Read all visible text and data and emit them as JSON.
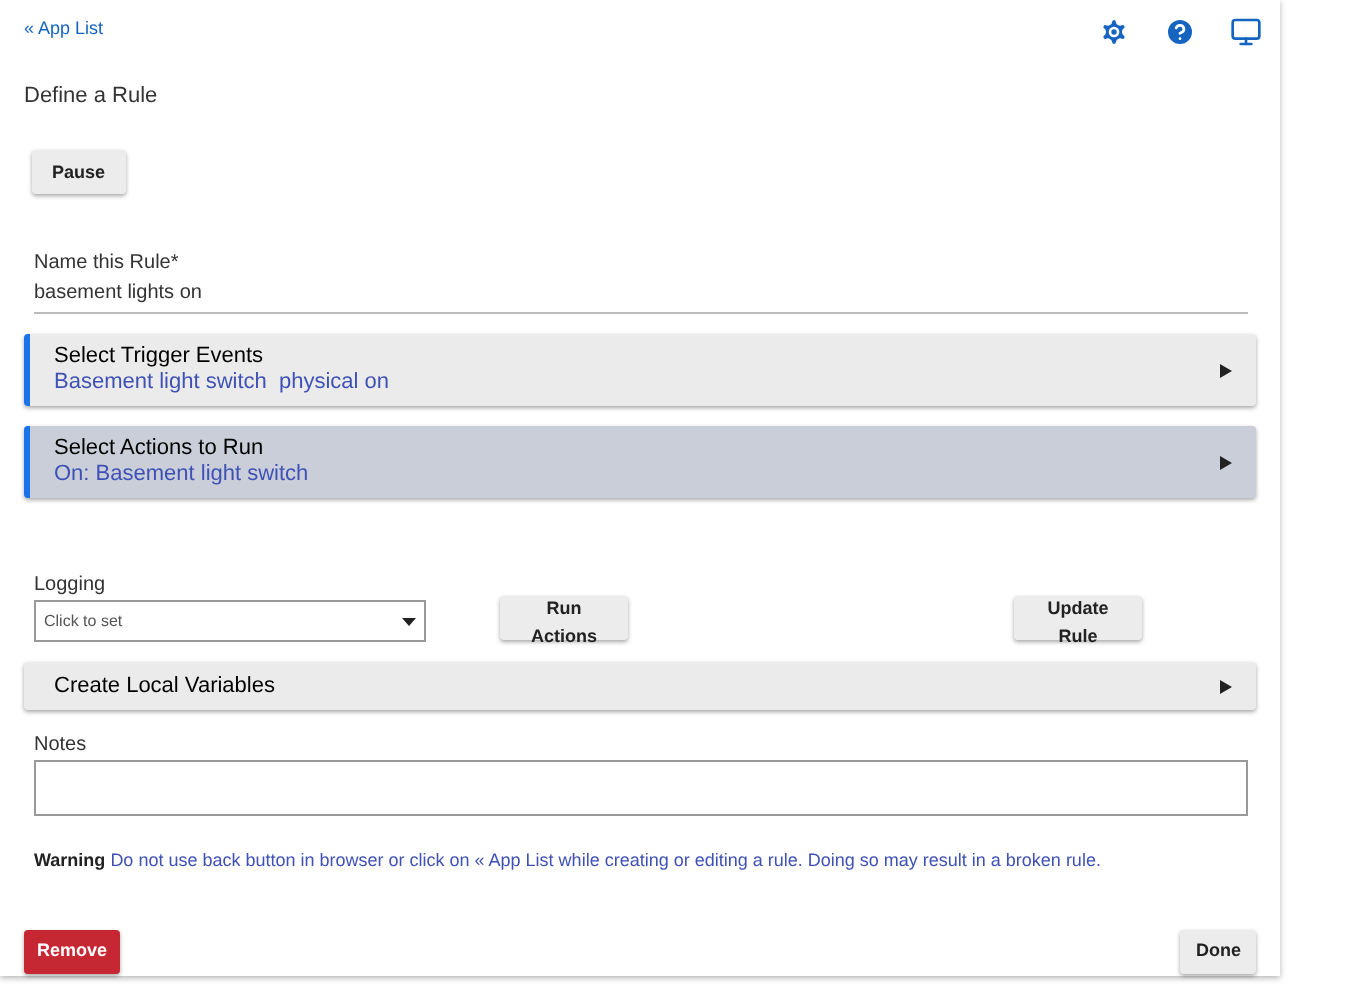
{
  "header": {
    "back_link": "« App List"
  },
  "title": "Define a Rule",
  "pause_button": "Pause",
  "name_field": {
    "label": "Name this Rule*",
    "value": "basement lights on"
  },
  "sections": [
    {
      "title": "Select Trigger Events",
      "subtitle": "Basement light switch  physical on",
      "accent": true,
      "highlighted": false
    },
    {
      "title": "Select Actions to Run",
      "subtitle": "On: Basement light switch",
      "accent": true,
      "highlighted": true
    }
  ],
  "logging": {
    "label": "Logging",
    "placeholder": "Click to set"
  },
  "run_actions_button": "Run Actions",
  "update_rule_button": "Update Rule",
  "local_variables": {
    "title": "Create Local Variables",
    "accent": false,
    "highlighted": false
  },
  "notes": {
    "label": "Notes"
  },
  "warning": {
    "label": "Warning",
    "message": "Do not use back button in browser or click on « App List while creating or editing a rule. Doing so may result in a broken rule."
  },
  "remove_button": "Remove",
  "done_button": "Done"
}
